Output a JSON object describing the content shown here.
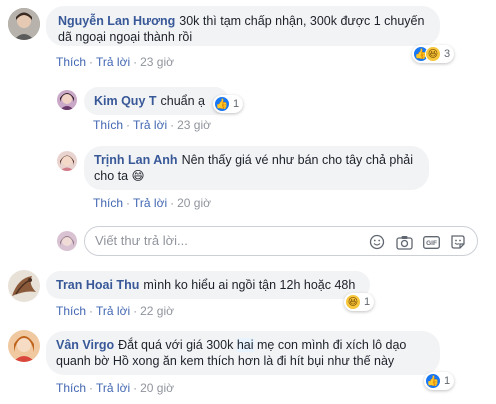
{
  "comments": [
    {
      "author": "Nguyễn Lan Hương",
      "text": "30k thì tạm chấp nhận, 300k được 1 chuyến dã ngoại ngoại thành rồi",
      "like": "Thích",
      "reply": "Trả lời",
      "time": "23 giờ",
      "reaction_count": "3"
    },
    {
      "author": "Kim Quy T",
      "text": "chuẩn ạ",
      "like": "Thích",
      "reply": "Trả lời",
      "time": "23 giờ",
      "reaction_count": "1"
    },
    {
      "author": "Trịnh Lan Anh",
      "text": "Nên thấy giá vé như bán cho tây chả phải cho ta",
      "emoji": "😄",
      "like": "Thích",
      "reply": "Trả lời",
      "time": "20 giờ"
    },
    {
      "author": "Tran Hoai Thu",
      "text": "mình ko hiểu ai ngồi tận 12h hoặc 48h",
      "like": "Thích",
      "reply": "Trả lời",
      "time": "22 giờ",
      "reaction_count": "1"
    },
    {
      "author": "Vân Virgo",
      "text_before": "Đắt quá với giá 300k",
      "text_highlight": "hai",
      "text_after": "mẹ con mình đi xích lô dạo quanh bờ Hồ xong ăn kem thích hơn là đi hít bụi như thế này",
      "like": "Thích",
      "reply": "Trả lời",
      "time": "20 giờ",
      "reaction_count": "1"
    }
  ],
  "reply_box": {
    "placeholder": "Viết thư trả lời..."
  },
  "separator": "·",
  "colors": {
    "link": "#385898",
    "action": "#4267b2",
    "bubble": "#f2f3f5",
    "muted": "#90949c"
  }
}
